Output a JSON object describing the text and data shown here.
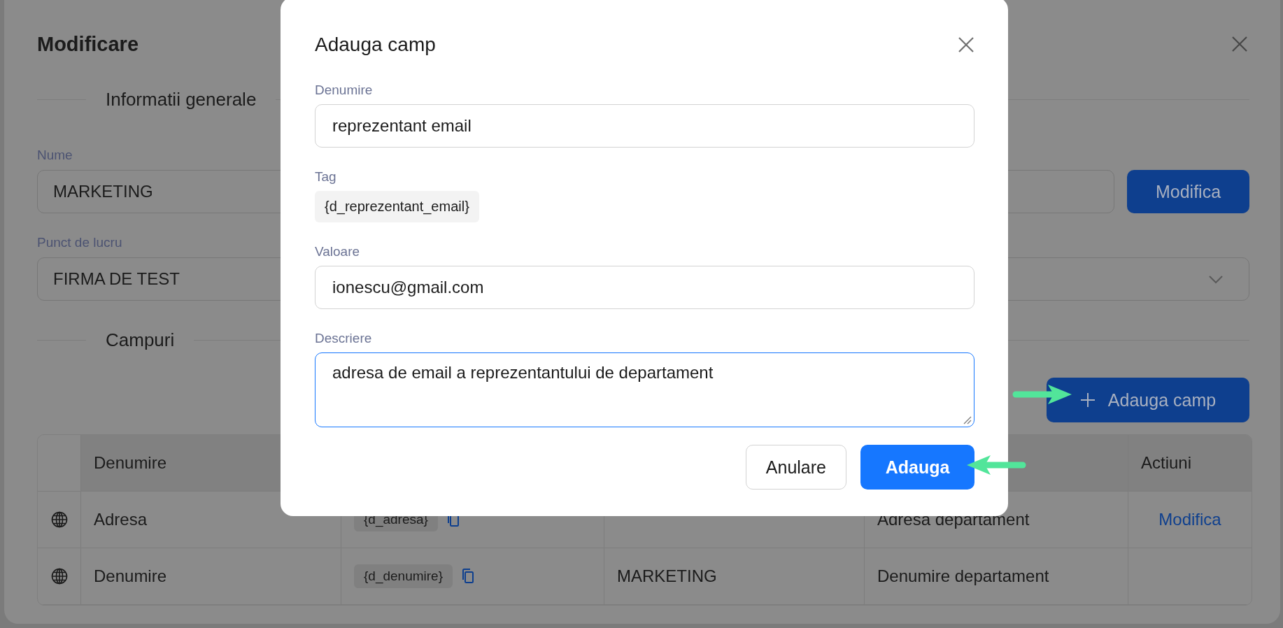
{
  "edit_dialog": {
    "title": "Modificare",
    "general_section": {
      "heading": "Informatii generale"
    },
    "name_field": {
      "label": "Nume",
      "value": "MARKETING"
    },
    "modify_button": {
      "label": "Modifica"
    },
    "workpoint_field": {
      "label": "Punct de lucru",
      "value": "FIRMA DE TEST"
    },
    "fields_section": {
      "heading": "Campuri"
    },
    "add_field_button": {
      "label": "Adauga camp"
    },
    "table": {
      "columns": [
        {
          "label": "Denumire"
        },
        {
          "label": "Actiuni"
        }
      ],
      "rows": [
        {
          "name": "Adresa",
          "tag": "{d_adresa}",
          "description": "Adresa departament",
          "action": "Modifica"
        },
        {
          "name": "Denumire",
          "tag": "{d_denumire}",
          "value": "MARKETING",
          "description": "Denumire departament"
        }
      ]
    }
  },
  "add_field_dialog": {
    "title": "Adauga camp",
    "fields": [
      {
        "kind": "input",
        "label": "Denumire",
        "value": "reprezentant email",
        "focused": false
      },
      {
        "kind": "tag",
        "label": "Tag",
        "value": "{d_reprezentant_email}"
      },
      {
        "kind": "input",
        "label": "Valoare",
        "value": "ionescu@gmail.com",
        "focused": false
      },
      {
        "kind": "textarea",
        "label": "Descriere",
        "value": "adresa de email a reprezentantului de departament",
        "focused": true
      }
    ],
    "buttons": [
      {
        "kind": "secondary",
        "label": "Anulare"
      },
      {
        "kind": "primary",
        "label": "Adauga"
      }
    ]
  }
}
